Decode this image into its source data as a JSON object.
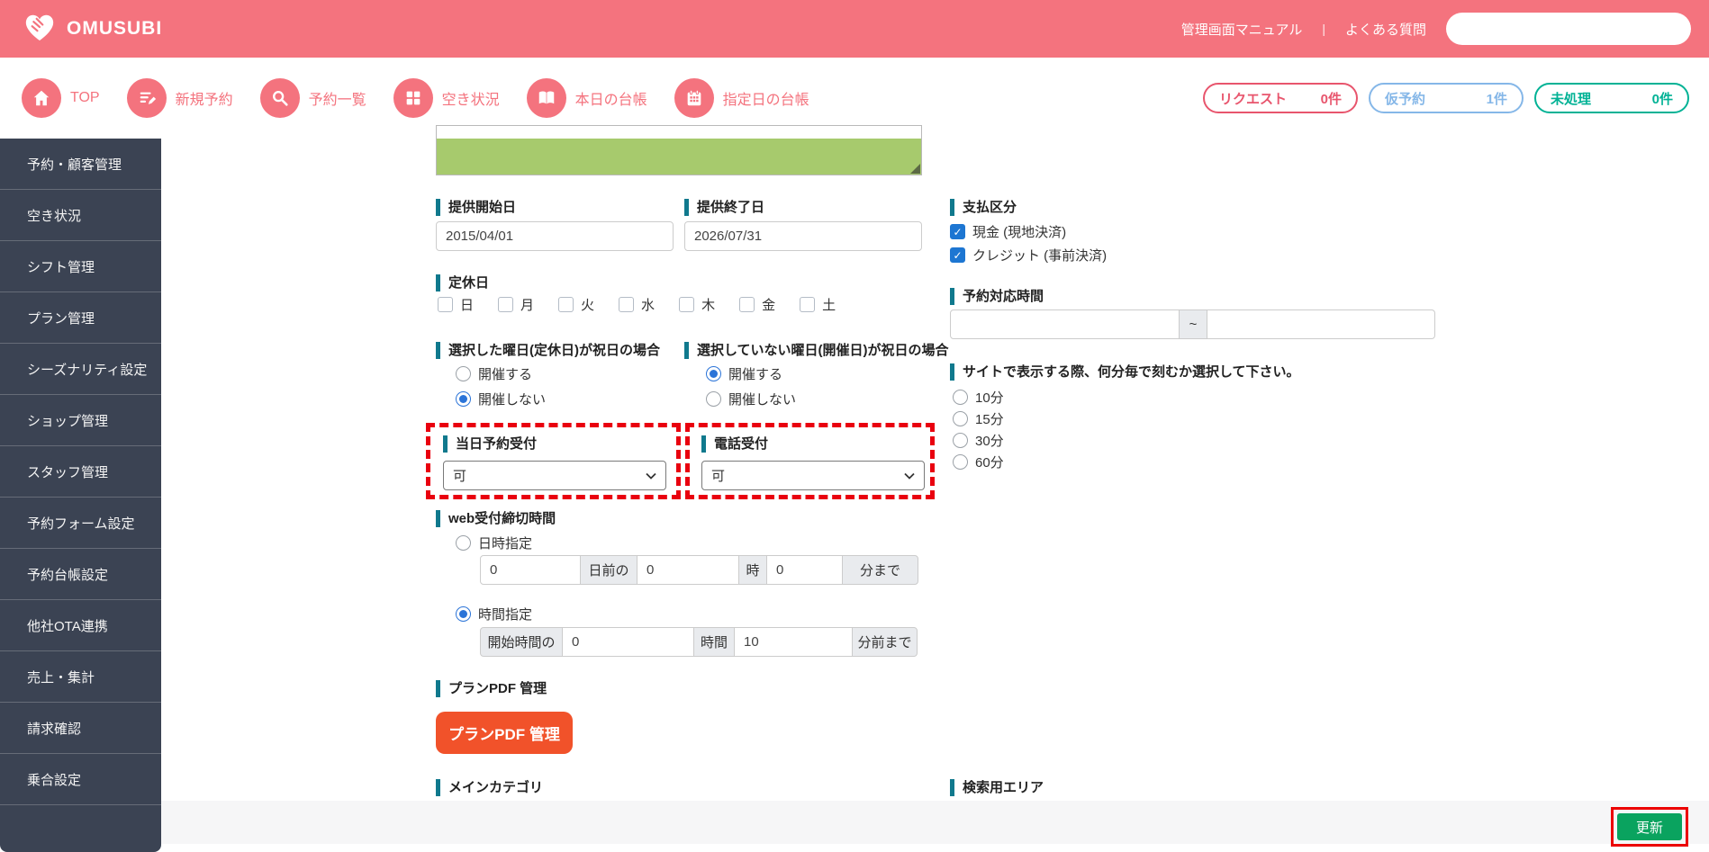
{
  "header": {
    "brand": "OMUSUBI",
    "manual_link": "管理画面マニュアル",
    "separator": "|",
    "faq_link": "よくある質問",
    "search_value": ""
  },
  "nav": {
    "items": [
      {
        "label": "TOP",
        "icon": "home-icon"
      },
      {
        "label": "新規予約",
        "icon": "new-reservation-icon"
      },
      {
        "label": "予約一覧",
        "icon": "reservation-list-icon"
      },
      {
        "label": "空き状況",
        "icon": "availability-icon"
      },
      {
        "label": "本日の台帳",
        "icon": "today-ledger-icon"
      },
      {
        "label": "指定日の台帳",
        "icon": "date-ledger-icon"
      }
    ],
    "badges": [
      {
        "label": "リクエスト",
        "count": "0件"
      },
      {
        "label": "仮予約",
        "count": "1件"
      },
      {
        "label": "未処理",
        "count": "0件"
      }
    ]
  },
  "sidebar": {
    "items": [
      "予約・顧客管理",
      "空き状況",
      "シフト管理",
      "プラン管理",
      "シーズナリティ設定",
      "ショップ管理",
      "スタッフ管理",
      "予約フォーム設定",
      "予約台帳設定",
      "他社OTA連携",
      "売上・集計",
      "請求確認",
      "乗合設定"
    ]
  },
  "form": {
    "offer_start": {
      "label": "提供開始日",
      "value": "2015/04/01"
    },
    "offer_end": {
      "label": "提供終了日",
      "value": "2026/07/31"
    },
    "payment": {
      "label": "支払区分",
      "options": [
        {
          "label": "現金 (現地決済)",
          "checked": true
        },
        {
          "label": "クレジット (事前決済)",
          "checked": true
        }
      ]
    },
    "closed_days": {
      "label": "定休日",
      "days": [
        "日",
        "月",
        "火",
        "水",
        "木",
        "金",
        "土"
      ]
    },
    "reservation_hours": {
      "label": "予約対応時間",
      "separator": "~",
      "from_value": "",
      "to_value": ""
    },
    "selected_holiday": {
      "label": "選択した曜日(定休日)が祝日の場合",
      "options": [
        {
          "label": "開催する",
          "selected": false
        },
        {
          "label": "開催しない",
          "selected": true
        }
      ]
    },
    "unselected_holiday": {
      "label": "選択していない曜日(開催日)が祝日の場合",
      "options": [
        {
          "label": "開催する",
          "selected": true
        },
        {
          "label": "開催しない",
          "selected": false
        }
      ]
    },
    "interval": {
      "label": "サイトで表示する際、何分毎で刻むか選択して下さい。",
      "options": [
        "10分",
        "15分",
        "30分",
        "60分"
      ]
    },
    "same_day": {
      "label": "当日予約受付",
      "value": "可"
    },
    "phone": {
      "label": "電話受付",
      "value": "可"
    },
    "web_deadline": {
      "label": "web受付締切時間",
      "datetime": {
        "radio_label": "日時指定",
        "selected": false,
        "day_value": "0",
        "hour_value": "0",
        "minute_value": "0",
        "addon_day": "日前の",
        "addon_hour": "時",
        "addon_minute": "分まで"
      },
      "time": {
        "radio_label": "時間指定",
        "selected": true,
        "addon_prefix": "開始時間の",
        "hour_value": "0",
        "minute_value": "10",
        "addon_hour": "時間",
        "addon_minute": "分前まで"
      }
    },
    "pdf": {
      "label": "プランPDF 管理",
      "button_label": "プランPDF 管理"
    },
    "main_category": {
      "label": "メインカテゴリ"
    },
    "search_area": {
      "label": "検索用エリア"
    }
  },
  "footer": {
    "update_label": "更新"
  },
  "colors": {
    "accent_pink": "#f4737e",
    "label_bar_teal": "#10798d",
    "annotation_red": "#e9000f",
    "update_green": "#0aa35f",
    "textarea_green": "#a7ca6d",
    "sidebar_dark": "#3b4353",
    "checkbox_blue": "#1d76d2",
    "badge_request": "#e8556d",
    "badge_tentative": "#85b7e8",
    "badge_unprocessed": "#00b295"
  }
}
